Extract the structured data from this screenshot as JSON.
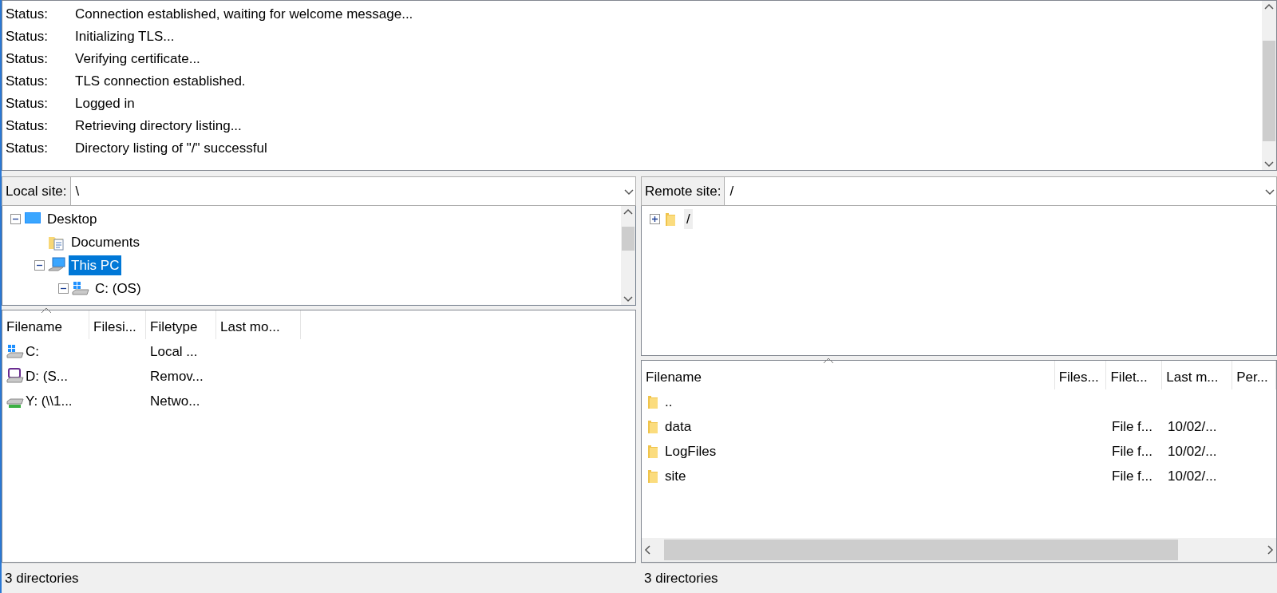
{
  "log": [
    {
      "label": "Status:",
      "message": "Connection established, waiting for welcome message..."
    },
    {
      "label": "Status:",
      "message": "Initializing TLS..."
    },
    {
      "label": "Status:",
      "message": "Verifying certificate..."
    },
    {
      "label": "Status:",
      "message": "TLS connection established."
    },
    {
      "label": "Status:",
      "message": "Logged in"
    },
    {
      "label": "Status:",
      "message": "Retrieving directory listing..."
    },
    {
      "label": "Status:",
      "message": "Directory listing of \"/\" successful"
    }
  ],
  "local": {
    "site_label": "Local site:",
    "path": "\\",
    "tree_focused": true,
    "tree": [
      {
        "label": "Desktop",
        "kind": "desktop",
        "expanded": true,
        "selected": false,
        "children": [
          {
            "label": "Documents",
            "kind": "documents",
            "selected": false
          },
          {
            "label": "This PC",
            "kind": "computer",
            "expanded": true,
            "selected": true,
            "children": [
              {
                "label": "C: (OS)",
                "kind": "drive",
                "expanded": true,
                "selected": false
              }
            ]
          }
        ]
      }
    ],
    "columns": [
      {
        "label": "Filename",
        "sorted": true
      },
      {
        "label": "Filesi...",
        "sorted": false
      },
      {
        "label": "Filetype",
        "sorted": false
      },
      {
        "label": "Last mo...",
        "sorted": false
      }
    ],
    "rows": [
      {
        "kind": "drive",
        "cells": [
          "C:",
          "",
          "Local ..."
        ]
      },
      {
        "kind": "card",
        "cells": [
          "D: (S...",
          "",
          "Remov..."
        ]
      },
      {
        "kind": "network",
        "cells": [
          "Y: (\\\\1...",
          "",
          "Netwo..."
        ]
      }
    ],
    "status": "3 directories"
  },
  "remote": {
    "site_label": "Remote site:",
    "path": "/",
    "tree_focused": false,
    "tree": [
      {
        "label": "/",
        "kind": "folder",
        "expanded": false,
        "selected": true
      }
    ],
    "columns": [
      {
        "label": "Filename",
        "sorted": true
      },
      {
        "label": "Files...",
        "sorted": false
      },
      {
        "label": "Filet...",
        "sorted": false
      },
      {
        "label": "Last m...",
        "sorted": false
      },
      {
        "label": "Per...",
        "sorted": false
      }
    ],
    "rows": [
      {
        "kind": "folder",
        "cells": [
          "..",
          "",
          "",
          ""
        ]
      },
      {
        "kind": "folder",
        "cells": [
          "data",
          "",
          "File f...",
          "10/02/..."
        ]
      },
      {
        "kind": "folder",
        "cells": [
          "LogFiles",
          "",
          "File f...",
          "10/02/..."
        ]
      },
      {
        "kind": "folder",
        "cells": [
          "site",
          "",
          "File f...",
          "10/02/..."
        ]
      }
    ],
    "status": "3 directories"
  }
}
